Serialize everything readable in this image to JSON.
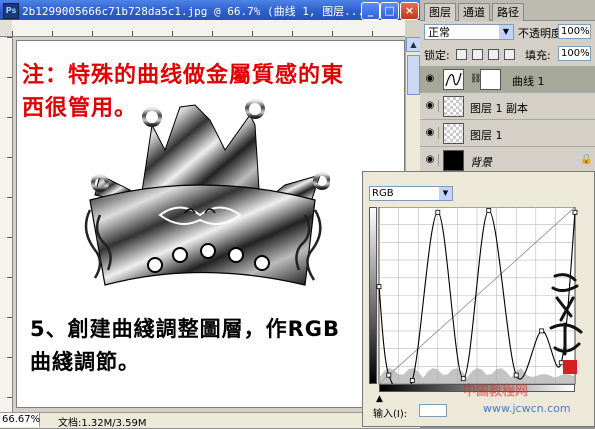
{
  "document": {
    "title": "2b1299005666c71b728da5c1.jpg @ 66.7% (曲线 1, 图层...",
    "app_icon": "Ps",
    "minimize_glyph": "_",
    "maximize_glyph": "□",
    "close_glyph": "×"
  },
  "canvas": {
    "note_line1": "注：特殊的曲线做金屬質感的東",
    "note_line2": "西很管用。",
    "step_line1": "5、創建曲綫調整圖層，作RGB",
    "step_line2": "曲綫調節。"
  },
  "statusbar": {
    "zoom": "66.67%",
    "doc_info": "文档:1.32M/3.59M"
  },
  "layers_panel": {
    "tabs": [
      "图层",
      "通道",
      "路径"
    ],
    "blend_mode": "正常",
    "opacity_label": "不透明度:",
    "opacity_value": "100%",
    "lock_label": "锁定:",
    "fill_label": "填充:",
    "fill_value": "100%",
    "layers": [
      {
        "name": "曲线 1",
        "selected": true
      },
      {
        "name": "图层 1 副本",
        "selected": false
      },
      {
        "name": "图层 1",
        "selected": false
      },
      {
        "name": "背景",
        "selected": false
      }
    ]
  },
  "curves": {
    "channel": "RGB",
    "input_label": "输入(I):",
    "curve_points": [
      [
        0,
        0.55
      ],
      [
        0.05,
        0.05
      ],
      [
        0.17,
        0.02
      ],
      [
        0.3,
        0.97
      ],
      [
        0.43,
        0.03
      ],
      [
        0.56,
        0.98
      ],
      [
        0.7,
        0.05
      ],
      [
        0.83,
        0.3
      ],
      [
        0.93,
        0.12
      ],
      [
        1,
        0.97
      ]
    ]
  },
  "watermark": {
    "site_cn": "中国教程网",
    "site_url": "www.jcwcn.com"
  },
  "colors": {
    "accent_red": "#e30000",
    "title_blue": "#2e5fcb",
    "selected_layer": "#a6a89a"
  }
}
